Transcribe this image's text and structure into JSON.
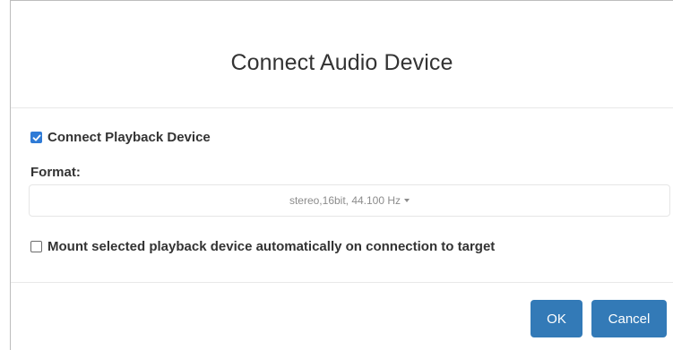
{
  "dialog": {
    "title": "Connect Audio Device",
    "playback": {
      "label": "Connect Playback Device",
      "checked": true
    },
    "format": {
      "label": "Format:",
      "selected": "stereo,16bit, 44.100 Hz"
    },
    "mount": {
      "label": "Mount selected playback device automatically on connection to target",
      "checked": false
    },
    "buttons": {
      "ok": "OK",
      "cancel": "Cancel"
    }
  },
  "colors": {
    "accent": "#337ab7",
    "checkbox": "#2f7bd6"
  }
}
